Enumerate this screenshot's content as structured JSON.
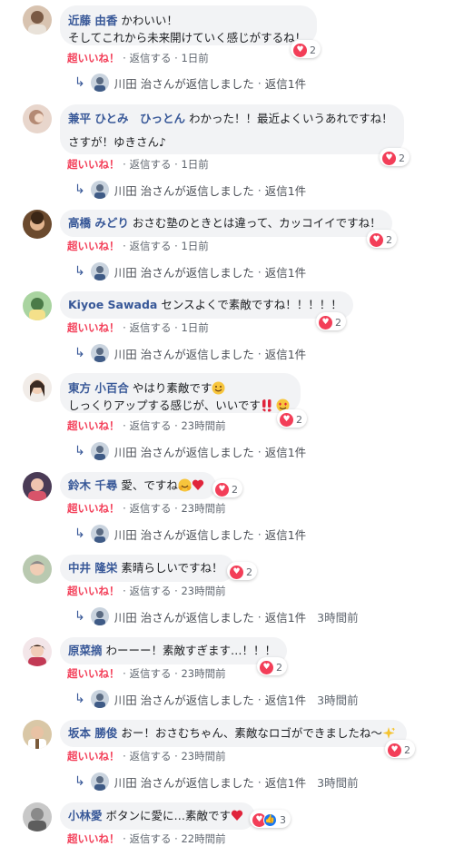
{
  "labels": {
    "super_like": "超いいね！",
    "reply": "返信する",
    "separator": "·",
    "replier_text": "川田 治さんが返信しました",
    "reply_count": "返信1件"
  },
  "colors": {
    "author_link": "#385898",
    "super_like": "#f33e58",
    "bubble_bg": "#f2f3f5",
    "meta_text": "#606770"
  },
  "comments": [
    {
      "author": "近藤 由香",
      "line1": "かわいい！",
      "line2": "そしてこれから未来開けていく感じがするね！",
      "reaction_icons": [
        "heart-icon"
      ],
      "reaction_count": "2",
      "time": "1日前",
      "reply_time": ""
    },
    {
      "author": "兼平 ひとみ　ひっとん",
      "line1": "わかった！！最近よくいうあれですね！",
      "line2": "さすが！ゆきさん♪",
      "reaction_icons": [
        "heart-icon"
      ],
      "reaction_count": "2",
      "time": "1日前",
      "reply_time": ""
    },
    {
      "author": "高橋 みどり",
      "line1": "おさむ塾のときとは違って、カッコイイですね！",
      "reaction_icons": [
        "heart-icon"
      ],
      "reaction_count": "2",
      "time": "1日前",
      "reply_time": ""
    },
    {
      "author": "Kiyoe Sawada",
      "line1": "センスよくで素敵ですね！！！！！",
      "reaction_icons": [
        "heart-icon"
      ],
      "reaction_count": "2",
      "time": "1日前",
      "reply_time": ""
    },
    {
      "author": "東方 小百合",
      "line1": "やはり素敵です",
      "line1_emoji": "smiling-face-icon",
      "line2": "しっくりアップする感じが、いいです",
      "line2_emoji": [
        "double-exclamation-icon",
        "heart-eyes-face-icon"
      ],
      "reaction_icons": [
        "heart-icon"
      ],
      "reaction_count": "2",
      "time": "23時間前",
      "reply_time": ""
    },
    {
      "author": "鈴木 千尋",
      "line1": "愛、ですね",
      "line1_emoji": [
        "hugging-face-icon",
        "heart-icon"
      ],
      "reaction_icons": [
        "heart-icon"
      ],
      "reaction_count": "2",
      "time": "23時間前",
      "reply_time": ""
    },
    {
      "author": "中井 隆栄",
      "line1": "素晴らしいですね！",
      "reaction_icons": [
        "heart-icon"
      ],
      "reaction_count": "2",
      "time": "23時間前",
      "reply_time": "3時間前"
    },
    {
      "author": "原菜摘",
      "line1": "わーーー！素敵すぎます…！！！",
      "reaction_icons": [
        "heart-icon"
      ],
      "reaction_count": "2",
      "time": "23時間前",
      "reply_time": "3時間前"
    },
    {
      "author": "坂本 勝俊",
      "line1": "おー！おさむちゃん、素敵なロゴができましたね〜",
      "line1_emoji": "sparkles-icon",
      "reaction_icons": [
        "heart-icon"
      ],
      "reaction_count": "2",
      "time": "23時間前",
      "reply_time": "3時間前"
    },
    {
      "author": "小林愛",
      "line1": "ボタンに愛に…素敵です",
      "line1_emoji": "heart-icon",
      "reaction_icons": [
        "heart-icon",
        "like-icon"
      ],
      "reaction_count": "3",
      "time": "22時間前",
      "reply_time": ""
    }
  ]
}
